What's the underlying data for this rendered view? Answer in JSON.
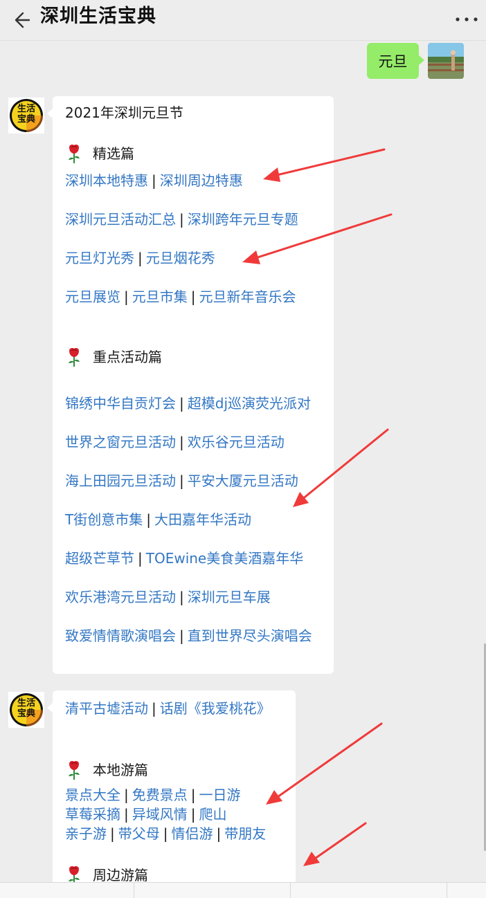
{
  "header": {
    "title": "深圳生活宝典",
    "back_icon": "arrow-left-icon",
    "more_icon": "more-dots-icon"
  },
  "outgoing": {
    "text": "元旦"
  },
  "bot": {
    "avatar_text_top": "生活",
    "avatar_text_bottom": "宝典"
  },
  "message1": {
    "title": "2021年深圳元旦节",
    "section1": {
      "heading": "精选篇",
      "rows": [
        [
          "深圳本地特惠",
          "深圳周边特惠"
        ],
        [
          "深圳元旦活动汇总",
          "深圳跨年元旦专题"
        ],
        [
          "元旦灯光秀",
          "元旦烟花秀"
        ],
        [
          "元旦展览",
          "元旦市集",
          "元旦新年音乐会"
        ]
      ]
    },
    "section2": {
      "heading": "重点活动篇",
      "rows": [
        [
          "锦绣中华自贡灯会",
          "超模dj巡演荧光派对"
        ],
        [
          "世界之窗元旦活动",
          "欢乐谷元旦活动"
        ],
        [
          "海上田园元旦活动",
          "平安大厦元旦活动"
        ],
        [
          "T街创意市集",
          "大田嘉年华活动"
        ],
        [
          "超级芒草节",
          "TOEwine美食美酒嘉年华"
        ],
        [
          "欢乐港湾元旦活动",
          "深圳元旦车展"
        ]
      ],
      "last_row": [
        "致爱情情歌演唱会",
        "直到世界尽头演唱会"
      ]
    }
  },
  "message2": {
    "first_row": [
      "清平古墟活动",
      "话剧《我爱桃花》"
    ],
    "section3": {
      "heading": "本地游篇",
      "rows": [
        [
          "景点大全",
          "免费景点",
          "一日游"
        ],
        [
          "草莓采摘",
          "异域风情",
          "爬山"
        ],
        [
          "亲子游",
          "带父母",
          "情侣游",
          "带朋友"
        ]
      ]
    },
    "section4": {
      "heading": "周边游篇"
    }
  },
  "separator": "|",
  "colors": {
    "background": "#ededed",
    "bubble_out": "#95ec69",
    "link": "#3377c4",
    "arrow": "#f03a3a"
  }
}
